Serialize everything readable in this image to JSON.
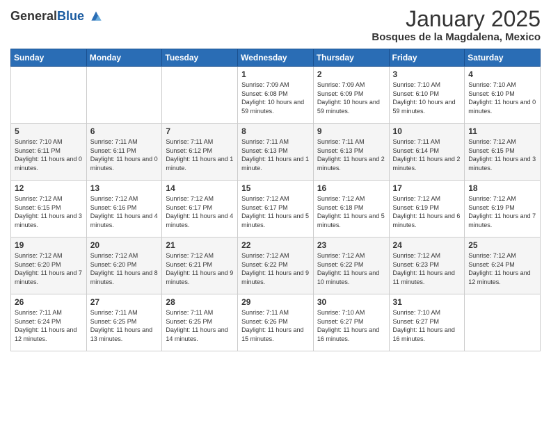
{
  "logo": {
    "general": "General",
    "blue": "Blue"
  },
  "header": {
    "title": "January 2025",
    "subtitle": "Bosques de la Magdalena, Mexico"
  },
  "days_of_week": [
    "Sunday",
    "Monday",
    "Tuesday",
    "Wednesday",
    "Thursday",
    "Friday",
    "Saturday"
  ],
  "weeks": [
    [
      {
        "day": "",
        "info": ""
      },
      {
        "day": "",
        "info": ""
      },
      {
        "day": "",
        "info": ""
      },
      {
        "day": "1",
        "info": "Sunrise: 7:09 AM\nSunset: 6:08 PM\nDaylight: 10 hours\nand 59 minutes."
      },
      {
        "day": "2",
        "info": "Sunrise: 7:09 AM\nSunset: 6:09 PM\nDaylight: 10 hours\nand 59 minutes."
      },
      {
        "day": "3",
        "info": "Sunrise: 7:10 AM\nSunset: 6:10 PM\nDaylight: 10 hours\nand 59 minutes."
      },
      {
        "day": "4",
        "info": "Sunrise: 7:10 AM\nSunset: 6:10 PM\nDaylight: 11 hours\nand 0 minutes."
      }
    ],
    [
      {
        "day": "5",
        "info": "Sunrise: 7:10 AM\nSunset: 6:11 PM\nDaylight: 11 hours\nand 0 minutes."
      },
      {
        "day": "6",
        "info": "Sunrise: 7:11 AM\nSunset: 6:11 PM\nDaylight: 11 hours\nand 0 minutes."
      },
      {
        "day": "7",
        "info": "Sunrise: 7:11 AM\nSunset: 6:12 PM\nDaylight: 11 hours\nand 1 minute."
      },
      {
        "day": "8",
        "info": "Sunrise: 7:11 AM\nSunset: 6:13 PM\nDaylight: 11 hours\nand 1 minute."
      },
      {
        "day": "9",
        "info": "Sunrise: 7:11 AM\nSunset: 6:13 PM\nDaylight: 11 hours\nand 2 minutes."
      },
      {
        "day": "10",
        "info": "Sunrise: 7:11 AM\nSunset: 6:14 PM\nDaylight: 11 hours\nand 2 minutes."
      },
      {
        "day": "11",
        "info": "Sunrise: 7:12 AM\nSunset: 6:15 PM\nDaylight: 11 hours\nand 3 minutes."
      }
    ],
    [
      {
        "day": "12",
        "info": "Sunrise: 7:12 AM\nSunset: 6:15 PM\nDaylight: 11 hours\nand 3 minutes."
      },
      {
        "day": "13",
        "info": "Sunrise: 7:12 AM\nSunset: 6:16 PM\nDaylight: 11 hours\nand 4 minutes."
      },
      {
        "day": "14",
        "info": "Sunrise: 7:12 AM\nSunset: 6:17 PM\nDaylight: 11 hours\nand 4 minutes."
      },
      {
        "day": "15",
        "info": "Sunrise: 7:12 AM\nSunset: 6:17 PM\nDaylight: 11 hours\nand 5 minutes."
      },
      {
        "day": "16",
        "info": "Sunrise: 7:12 AM\nSunset: 6:18 PM\nDaylight: 11 hours\nand 5 minutes."
      },
      {
        "day": "17",
        "info": "Sunrise: 7:12 AM\nSunset: 6:19 PM\nDaylight: 11 hours\nand 6 minutes."
      },
      {
        "day": "18",
        "info": "Sunrise: 7:12 AM\nSunset: 6:19 PM\nDaylight: 11 hours\nand 7 minutes."
      }
    ],
    [
      {
        "day": "19",
        "info": "Sunrise: 7:12 AM\nSunset: 6:20 PM\nDaylight: 11 hours\nand 7 minutes."
      },
      {
        "day": "20",
        "info": "Sunrise: 7:12 AM\nSunset: 6:20 PM\nDaylight: 11 hours\nand 8 minutes."
      },
      {
        "day": "21",
        "info": "Sunrise: 7:12 AM\nSunset: 6:21 PM\nDaylight: 11 hours\nand 9 minutes."
      },
      {
        "day": "22",
        "info": "Sunrise: 7:12 AM\nSunset: 6:22 PM\nDaylight: 11 hours\nand 9 minutes."
      },
      {
        "day": "23",
        "info": "Sunrise: 7:12 AM\nSunset: 6:22 PM\nDaylight: 11 hours\nand 10 minutes."
      },
      {
        "day": "24",
        "info": "Sunrise: 7:12 AM\nSunset: 6:23 PM\nDaylight: 11 hours\nand 11 minutes."
      },
      {
        "day": "25",
        "info": "Sunrise: 7:12 AM\nSunset: 6:24 PM\nDaylight: 11 hours\nand 12 minutes."
      }
    ],
    [
      {
        "day": "26",
        "info": "Sunrise: 7:11 AM\nSunset: 6:24 PM\nDaylight: 11 hours\nand 12 minutes."
      },
      {
        "day": "27",
        "info": "Sunrise: 7:11 AM\nSunset: 6:25 PM\nDaylight: 11 hours\nand 13 minutes."
      },
      {
        "day": "28",
        "info": "Sunrise: 7:11 AM\nSunset: 6:25 PM\nDaylight: 11 hours\nand 14 minutes."
      },
      {
        "day": "29",
        "info": "Sunrise: 7:11 AM\nSunset: 6:26 PM\nDaylight: 11 hours\nand 15 minutes."
      },
      {
        "day": "30",
        "info": "Sunrise: 7:10 AM\nSunset: 6:27 PM\nDaylight: 11 hours\nand 16 minutes."
      },
      {
        "day": "31",
        "info": "Sunrise: 7:10 AM\nSunset: 6:27 PM\nDaylight: 11 hours\nand 16 minutes."
      },
      {
        "day": "",
        "info": ""
      }
    ]
  ]
}
